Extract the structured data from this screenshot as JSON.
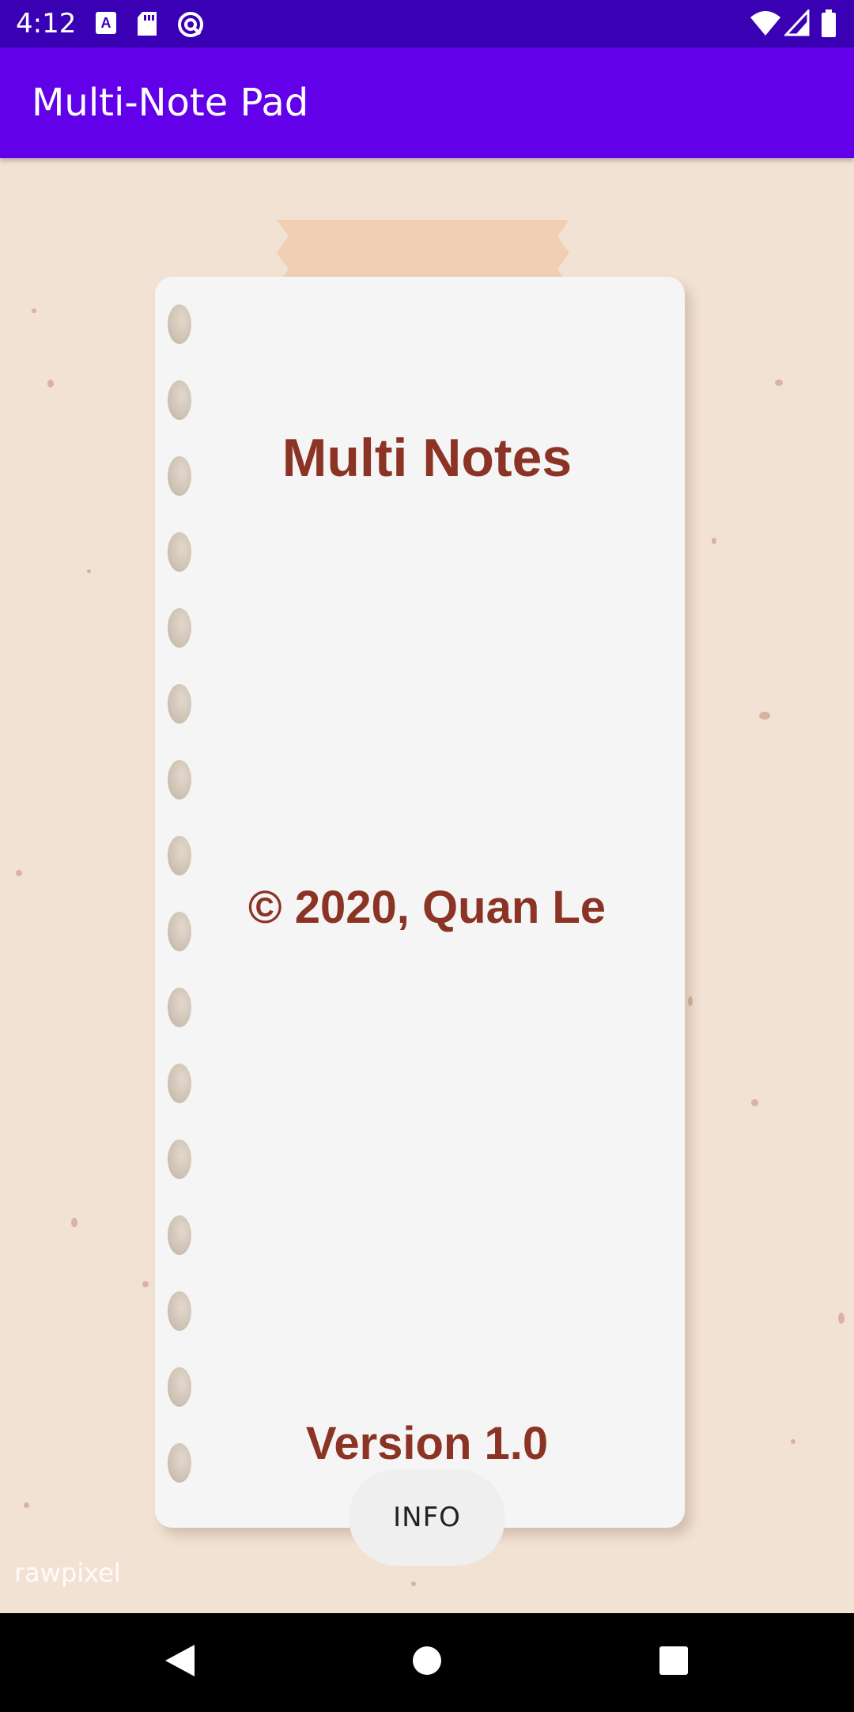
{
  "status_bar": {
    "time": "4:12",
    "left_icons": [
      "accessibility-a-icon",
      "sd-card-icon",
      "do-not-disturb-icon"
    ],
    "right_icons": [
      "wifi-icon",
      "cell-signal-icon",
      "battery-icon"
    ]
  },
  "app_bar": {
    "title": "Multi-Note Pad",
    "color": "#6200ea"
  },
  "note": {
    "title": "Multi Notes",
    "copyright": "© 2020, Quan Le",
    "version": "Version 1.0",
    "text_color": "#8b3324"
  },
  "info_button": {
    "label": "INFO"
  },
  "watermark": "rawpixel",
  "nav_bar": {
    "icons": [
      "back-icon",
      "home-icon",
      "recents-icon"
    ]
  }
}
